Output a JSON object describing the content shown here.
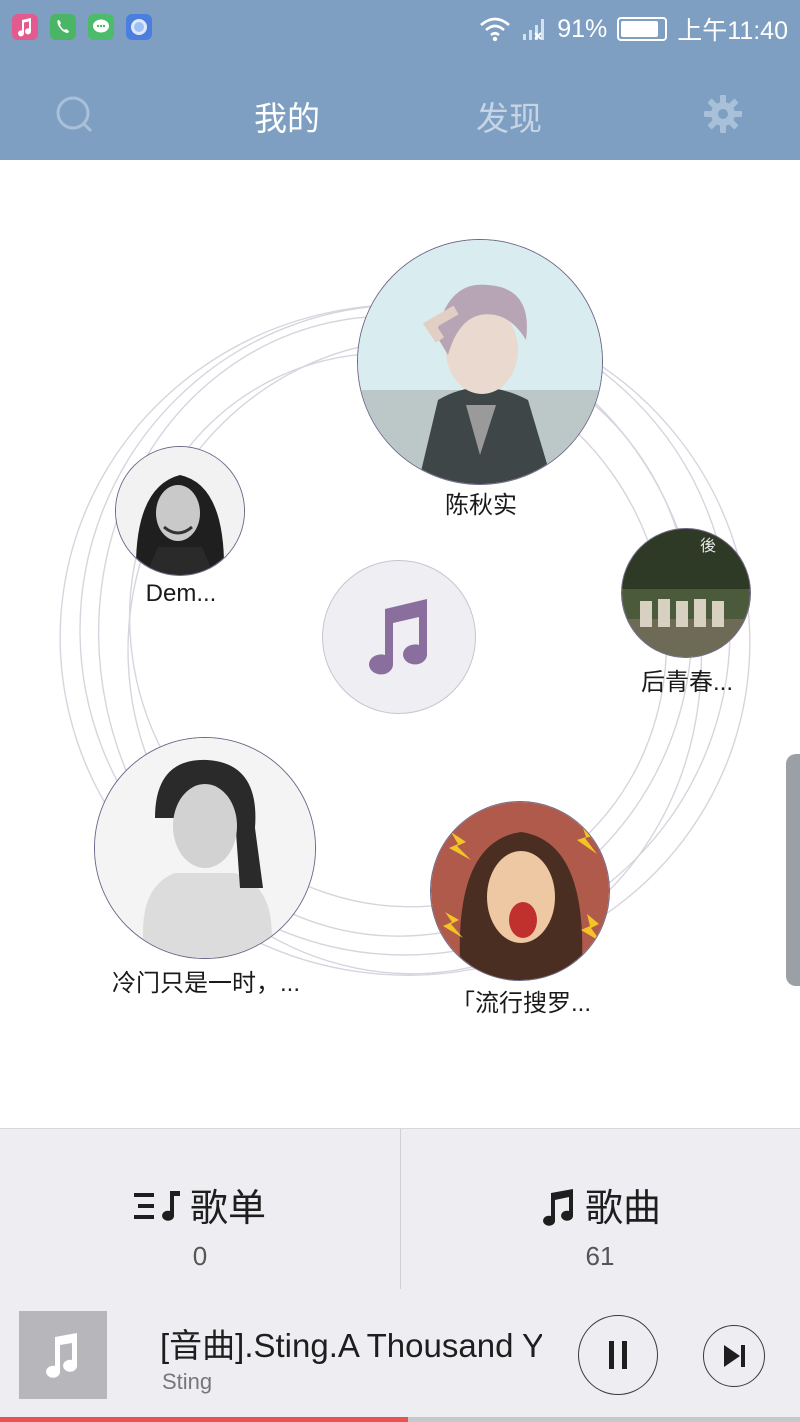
{
  "status_bar": {
    "apps": [
      "music-app-icon",
      "phone-app-icon",
      "messages-app-icon",
      "browser-app-icon"
    ],
    "battery": "91%",
    "battery_level": 0.91,
    "time": "上午11:40"
  },
  "header": {
    "tabs": [
      {
        "label": "我的",
        "active": true
      },
      {
        "label": "发现",
        "active": false
      }
    ]
  },
  "artists": [
    {
      "name": "陈秋实"
    },
    {
      "name": "Dem..."
    },
    {
      "name": "后青春..."
    },
    {
      "name": "冷门只是一时，..."
    },
    {
      "name": "「流行搜罗..."
    }
  ],
  "counters": {
    "playlists": {
      "label": "歌单",
      "count": "0"
    },
    "songs": {
      "label": "歌曲",
      "count": "61"
    }
  },
  "player": {
    "title": "[音曲].Sting.A Thousand Years",
    "artist": "Sting",
    "progress": 0.51
  },
  "colors": {
    "header": "#7f9fc2",
    "accent_purple": "#8a6e9e",
    "progress": "#e85252"
  }
}
